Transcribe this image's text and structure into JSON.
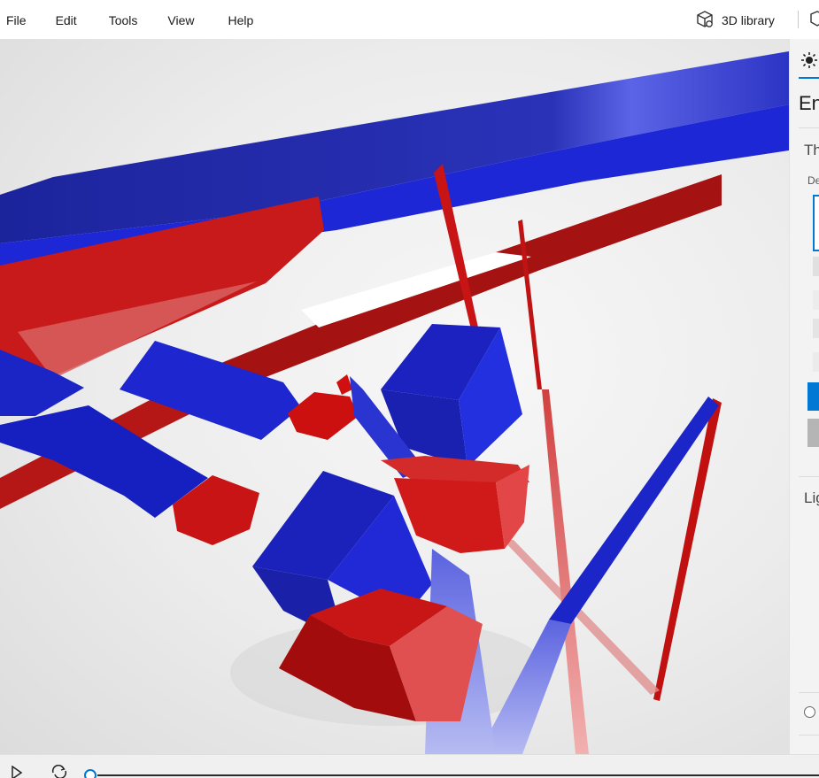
{
  "menu": {
    "items": [
      "File",
      "Edit",
      "Tools",
      "View",
      "Help"
    ]
  },
  "toolbar": {
    "library_label": "3D library"
  },
  "panel": {
    "title": "En",
    "theme_label": "Th",
    "default_label": "De",
    "lighting_label": "Lig"
  },
  "timeline": {
    "progress": 0
  },
  "colors": {
    "accent": "#0078d4",
    "blue_object": "#1a22c8",
    "red_object": "#c40000"
  },
  "icons": {
    "library": "cube-icon",
    "panel_tab": "sun-icon",
    "play": "play-icon",
    "loop": "loop-icon"
  }
}
